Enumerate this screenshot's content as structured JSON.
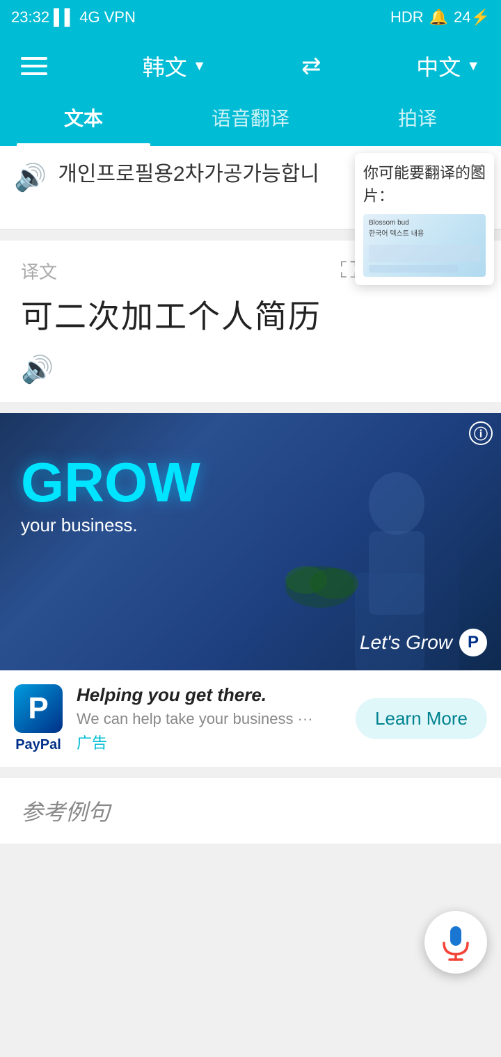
{
  "statusBar": {
    "time": "23:32",
    "signal": "4G",
    "battery": "24",
    "vpn": "VPN",
    "hdr": "HDR"
  },
  "topBar": {
    "sourceLang": "韩文",
    "targetLang": "中文",
    "swapIcon": "⇄"
  },
  "tabs": [
    {
      "id": "text",
      "label": "文本",
      "active": true
    },
    {
      "id": "voice",
      "label": "语音翻译",
      "active": false
    },
    {
      "id": "photo",
      "label": "拍译",
      "active": false
    }
  ],
  "inputText": "개인프로필용2차가공가능합니",
  "tooltip": {
    "text": "你可能要翻译的图片：",
    "imageAlt": "Blossom bud screenshot"
  },
  "translation": {
    "label": "译文",
    "result": "可二次加工个人简历",
    "icons": {
      "expand": "⛶",
      "copy": "❐",
      "share": "⎙",
      "like": "👍"
    }
  },
  "ad": {
    "growTitle": "GROW",
    "growSub": "your business.",
    "letsGrow": "Let's Grow",
    "headline": "Helping you get there.",
    "subtext": "We can help take your business ···",
    "guanggao": "广告",
    "learnMore": "Learn More",
    "paypalText": "PayPal"
  },
  "examples": {
    "label": "参考例句"
  },
  "micButton": {
    "label": "microphone"
  }
}
